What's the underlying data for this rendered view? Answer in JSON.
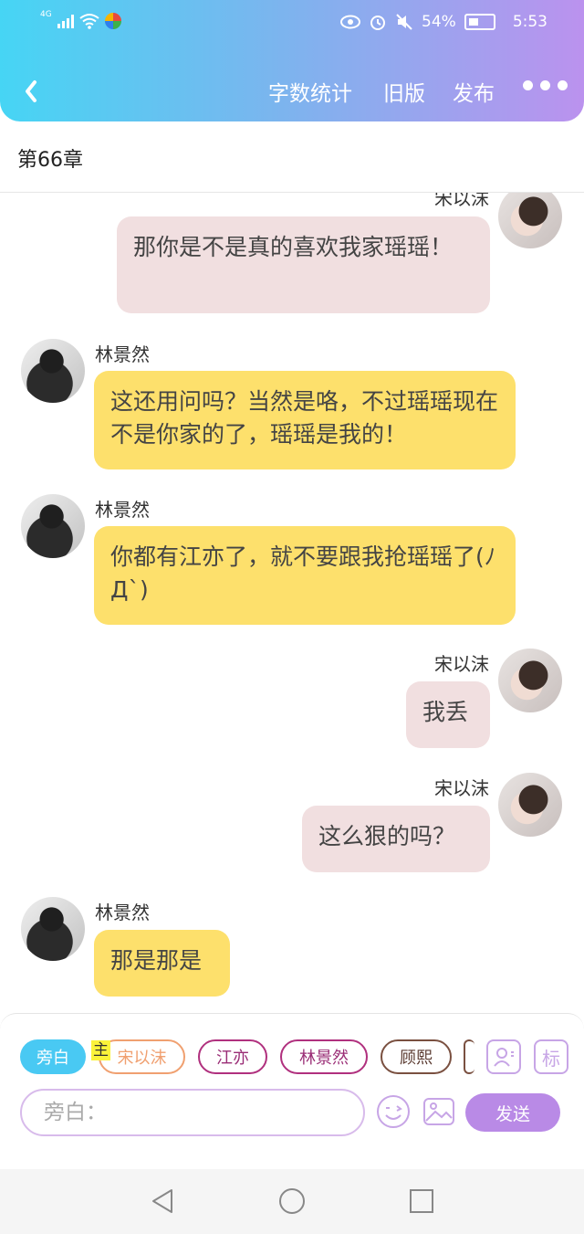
{
  "status_bar": {
    "network": "4G",
    "battery": "54%",
    "time": "5:53"
  },
  "toolbar": {
    "word_count": "字数统计",
    "old_version": "旧版",
    "publish": "发布"
  },
  "chapter_title": "第66章",
  "messages": [
    {
      "speaker": "宋以沫",
      "side": "right",
      "text": "那你是不是真的喜欢我家瑶瑶！"
    },
    {
      "speaker": "林景然",
      "side": "left",
      "text": "这还用问吗？当然是咯，不过瑶瑶现在不是你家的了，瑶瑶是我的！"
    },
    {
      "speaker": "林景然",
      "side": "left",
      "text": "你都有江亦了，就不要跟我抢瑶瑶了(ﾉДˋ)"
    },
    {
      "speaker": "宋以沫",
      "side": "right",
      "text": "我丢"
    },
    {
      "speaker": "宋以沫",
      "side": "right",
      "text": "这么狠的吗？"
    },
    {
      "speaker": "林景然",
      "side": "left",
      "text": "那是那是"
    }
  ],
  "composer": {
    "roles": [
      "旁白",
      "宋以沫",
      "江亦",
      "林景然",
      "顾熙"
    ],
    "main_tag": "主",
    "mark_label": "标",
    "input_placeholder": "旁白：",
    "send_label": "发送"
  },
  "colors": {
    "accent": "#b98ae6",
    "header_start": "#46d5f4",
    "header_end": "#bb92ee",
    "pink_bubble": "#f1dfe0",
    "yellow_bubble": "#fde06c"
  }
}
